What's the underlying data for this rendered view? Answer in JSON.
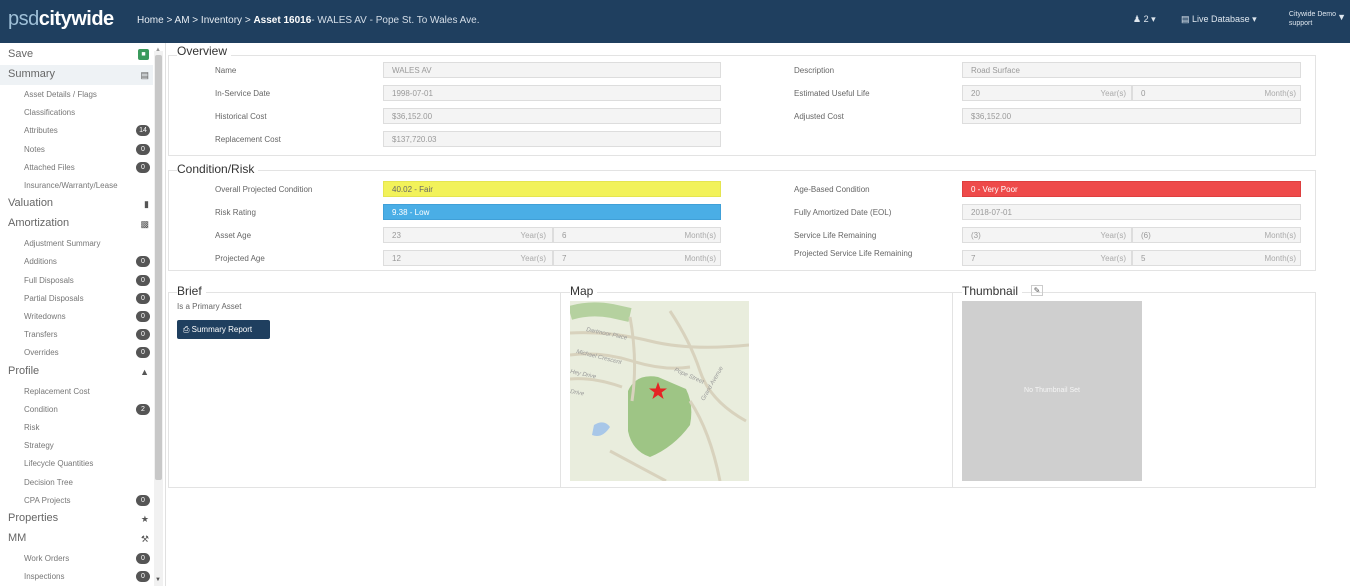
{
  "topbar": {
    "logo_a": "psd",
    "logo_b": "citywide",
    "crumb_prefix": "Home > AM > Inventory > ",
    "crumb_current": "Asset 16016",
    "crumb_tail": "- WALES AV - Pope St. To Wales Ave.",
    "users": "2",
    "database": "Live Database",
    "user_name": "Citywide Demo",
    "user_role": "support"
  },
  "sidebar": {
    "items": [
      {
        "label": "Save",
        "type": "sec"
      },
      {
        "label": "Summary",
        "type": "sec"
      },
      {
        "label": "Asset Details / Flags",
        "type": "sub"
      },
      {
        "label": "Classifications",
        "type": "sub"
      },
      {
        "label": "Attributes",
        "type": "sub",
        "badge": "14"
      },
      {
        "label": "Notes",
        "type": "sub",
        "badge": "0"
      },
      {
        "label": "Attached Files",
        "type": "sub",
        "badge": "0"
      },
      {
        "label": "Insurance/Warranty/Lease",
        "type": "sub"
      },
      {
        "label": "Valuation",
        "type": "sec"
      },
      {
        "label": "Amortization",
        "type": "sec"
      },
      {
        "label": "Adjustment Summary",
        "type": "sub"
      },
      {
        "label": "Additions",
        "type": "sub",
        "badge": "0"
      },
      {
        "label": "Full Disposals",
        "type": "sub",
        "badge": "0"
      },
      {
        "label": "Partial Disposals",
        "type": "sub",
        "badge": "0"
      },
      {
        "label": "Writedowns",
        "type": "sub",
        "badge": "0"
      },
      {
        "label": "Transfers",
        "type": "sub",
        "badge": "0"
      },
      {
        "label": "Overrides",
        "type": "sub",
        "badge": "0"
      },
      {
        "label": "Profile",
        "type": "sec"
      },
      {
        "label": "Replacement Cost",
        "type": "sub"
      },
      {
        "label": "Condition",
        "type": "sub",
        "badge": "2"
      },
      {
        "label": "Risk",
        "type": "sub"
      },
      {
        "label": "Strategy",
        "type": "sub"
      },
      {
        "label": "Lifecycle Quantities",
        "type": "sub"
      },
      {
        "label": "Decision Tree",
        "type": "sub"
      },
      {
        "label": "CPA Projects",
        "type": "sub",
        "badge": "0"
      },
      {
        "label": "Properties",
        "type": "sec"
      },
      {
        "label": "MM",
        "type": "sec"
      },
      {
        "label": "Work Orders",
        "type": "sub",
        "badge": "0"
      },
      {
        "label": "Inspections",
        "type": "sub",
        "badge": "0"
      }
    ]
  },
  "overview": {
    "title": "Overview",
    "name_label": "Name",
    "name": "WALES AV",
    "isd_label": "In-Service Date",
    "isd": "1998-07-01",
    "hc_label": "Historical Cost",
    "hc": "$36,152.00",
    "rc_label": "Replacement Cost",
    "rc": "$137,720.03",
    "desc_label": "Description",
    "desc": "Road Surface",
    "eul_label": "Estimated Useful Life",
    "eul_years": "20",
    "eul_months": "0",
    "ac_label": "Adjusted Cost",
    "ac": "$36,152.00",
    "years_unit": "Year(s)",
    "months_unit": "Month(s)"
  },
  "condition": {
    "title": "Condition/Risk",
    "opc_label": "Overall Projected Condition",
    "opc": "40.02 - Fair",
    "rr_label": "Risk Rating",
    "rr": "9.38 - Low",
    "age_label": "Asset Age",
    "age_y": "23",
    "age_m": "6",
    "page_label": "Projected Age",
    "page_y": "12",
    "page_m": "7",
    "abc_label": "Age-Based Condition",
    "abc": "0 - Very Poor",
    "fad_label": "Fully Amortized Date (EOL)",
    "fad": "2018-07-01",
    "slr_label": "Service Life Remaining",
    "slr_y": "(3)",
    "slr_m": "(6)",
    "pslr_label": "Projected Service Life Remaining",
    "pslr_y": "7",
    "pslr_m": "5",
    "highlight_colors": {
      "fair": "#f2f25a",
      "low": "#4aaee6",
      "very_poor": "#ee4a4a"
    }
  },
  "brief": {
    "title": "Brief",
    "text": "Is a Primary Asset",
    "button": "Summary Report"
  },
  "map": {
    "title": "Map",
    "streets": [
      "Dartmoor Place",
      "Michael Crescent",
      "Hey Drive",
      "Pope Street",
      "Grand Avenue",
      "Drive"
    ]
  },
  "thumbnail": {
    "title": "Thumbnail",
    "empty": "No Thumbnail Set"
  }
}
